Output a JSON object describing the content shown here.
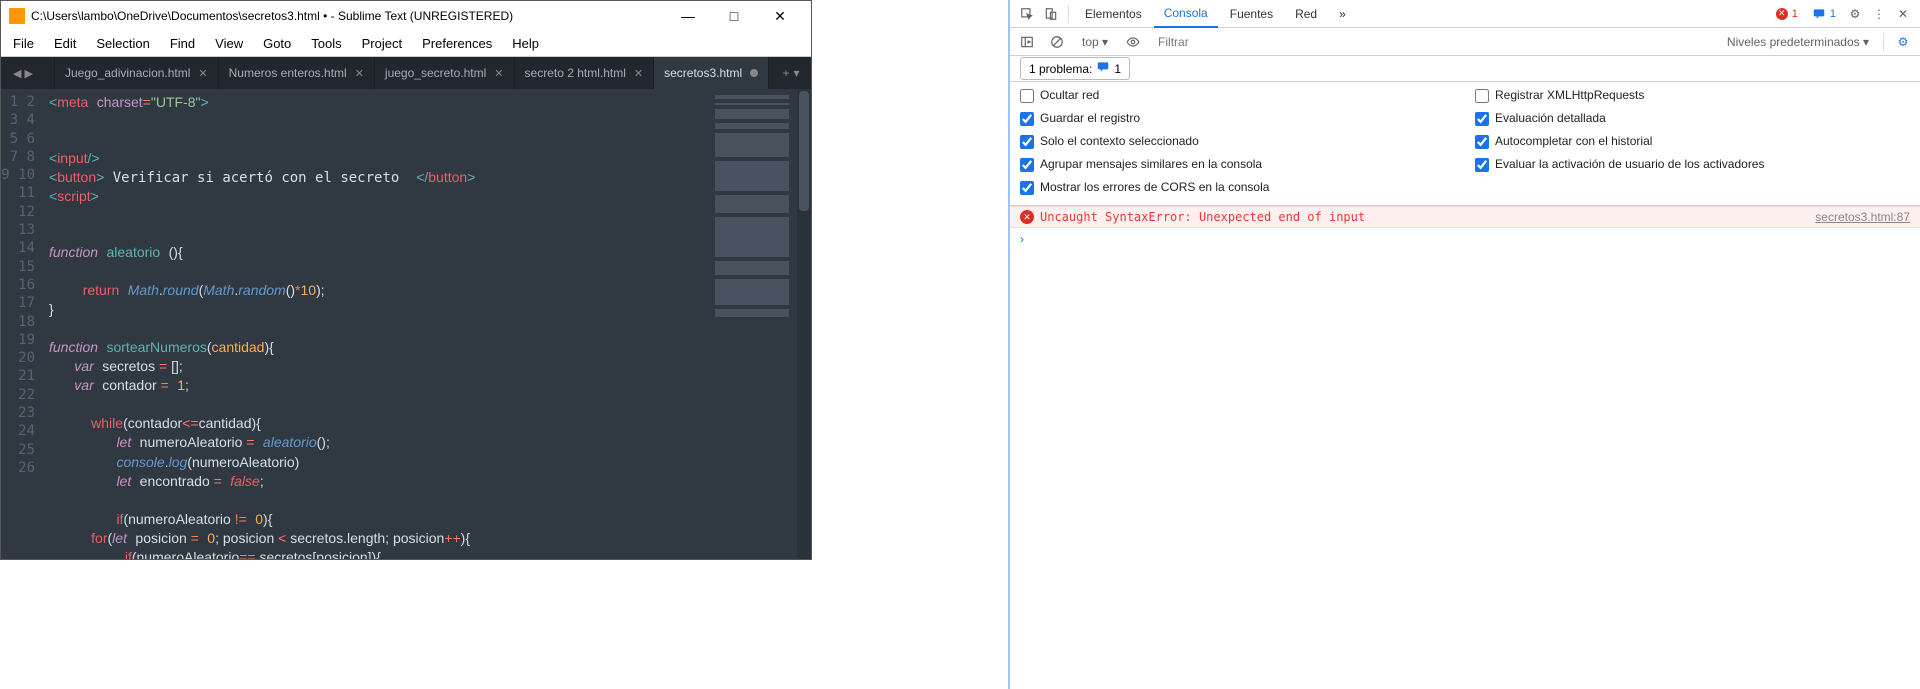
{
  "sublime": {
    "title": "C:\\Users\\lambo\\OneDrive\\Documentos\\secretos3.html • - Sublime Text (UNREGISTERED)",
    "menu": [
      "File",
      "Edit",
      "Selection",
      "Find",
      "View",
      "Goto",
      "Tools",
      "Project",
      "Preferences",
      "Help"
    ],
    "tabs": [
      {
        "label": "Juego_adivinacion.html",
        "modified": false
      },
      {
        "label": "Numeros enteros.html",
        "modified": false
      },
      {
        "label": "juego_secreto.html",
        "modified": false
      },
      {
        "label": "secreto 2 html.html",
        "modified": false
      },
      {
        "label": "secretos3.html",
        "modified": true
      }
    ],
    "active_tab": 4,
    "line_start": 1,
    "line_end": 26
  },
  "devtools": {
    "tabs": [
      "Elementos",
      "Consola",
      "Fuentes",
      "Red"
    ],
    "active_tab": 1,
    "more": "»",
    "error_count": "1",
    "msg_count": "1",
    "toolbar": {
      "context": "top ▾",
      "filter_placeholder": "Filtrar",
      "levels": "Niveles predeterminados ▾"
    },
    "issues": {
      "label": "1 problema:",
      "count": "1"
    },
    "settings": {
      "hide_network": {
        "label": "Ocultar red",
        "checked": false
      },
      "log_xhr": {
        "label": "Registrar XMLHttpRequests",
        "checked": false
      },
      "preserve_log": {
        "label": "Guardar el registro",
        "checked": true
      },
      "eager_eval": {
        "label": "Evaluación detallada",
        "checked": true
      },
      "selected_ctx": {
        "label": "Solo el contexto seleccionado",
        "checked": true
      },
      "autocomplete": {
        "label": "Autocompletar con el historial",
        "checked": true
      },
      "group_similar": {
        "label": "Agrupar mensajes similares en la consola",
        "checked": true
      },
      "user_activation": {
        "label": "Evaluar la activación de usuario de los activadores",
        "checked": true
      },
      "cors_errors": {
        "label": "Mostrar los errores de CORS en la consola",
        "checked": true
      }
    },
    "error": {
      "message": "Uncaught SyntaxError: Unexpected end of input",
      "source": "secretos3.html:87"
    },
    "prompt": "›"
  }
}
